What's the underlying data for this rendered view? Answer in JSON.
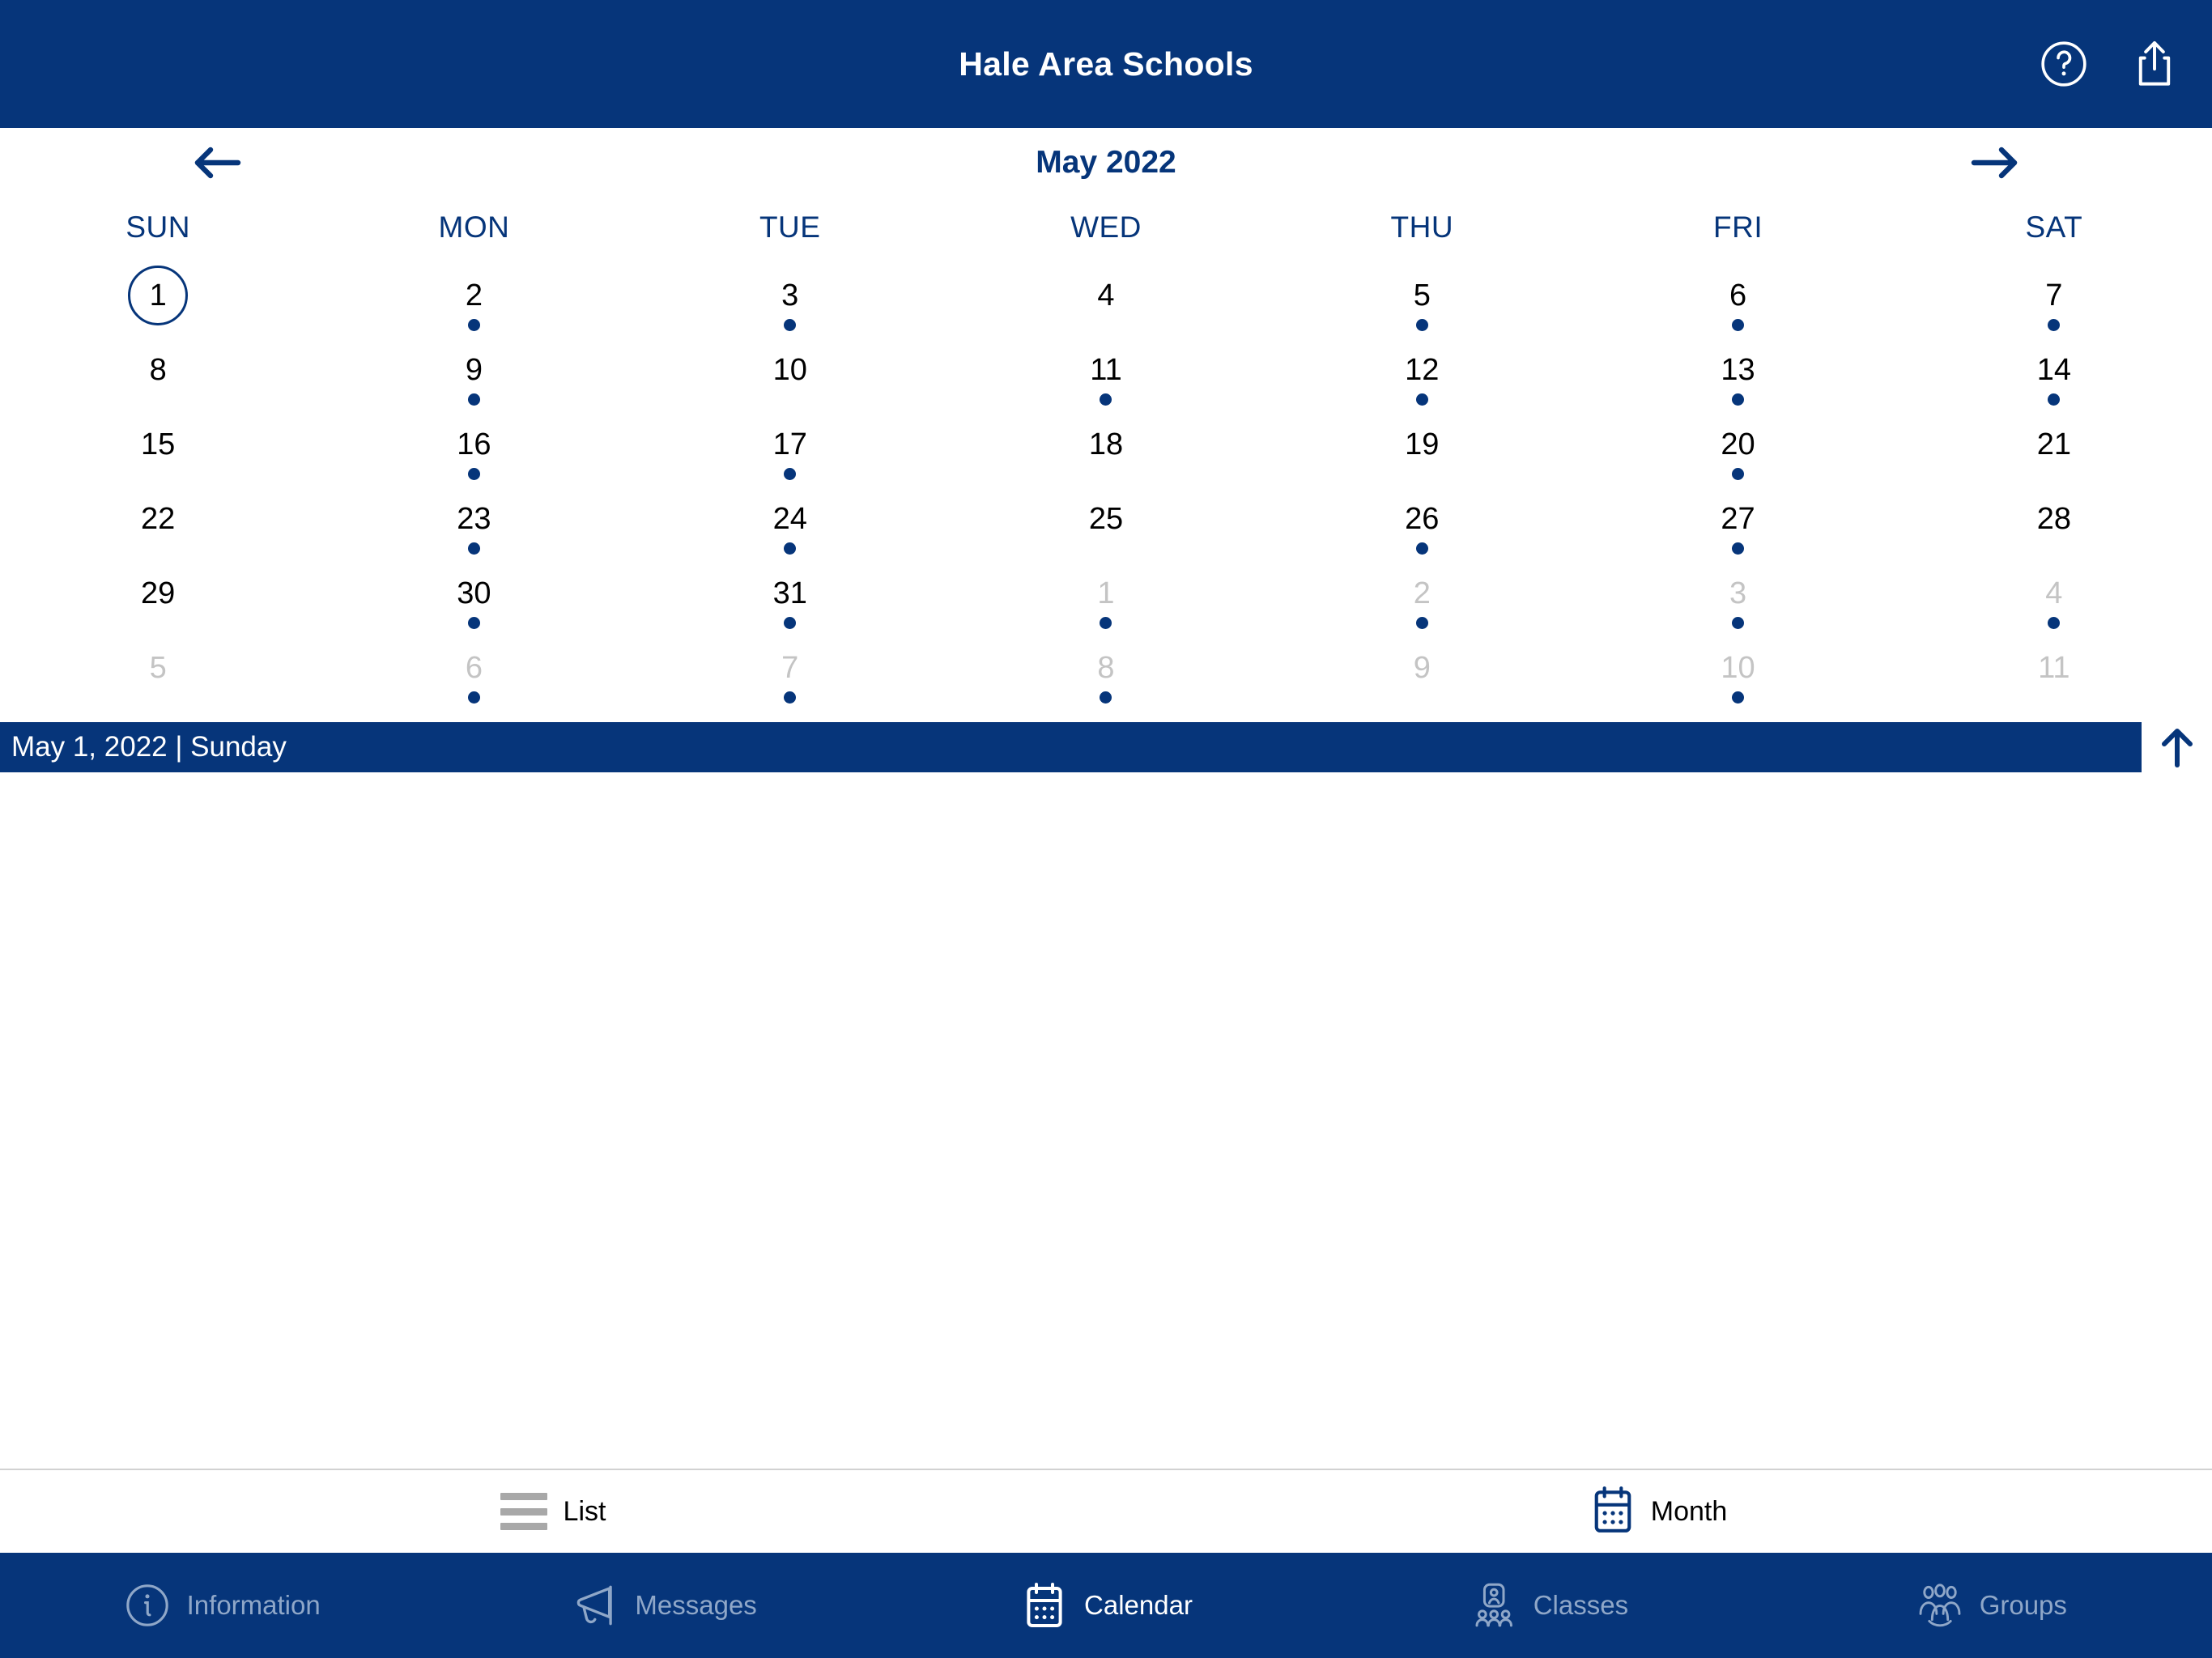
{
  "header": {
    "title": "Hale Area Schools",
    "help_icon": "help-circle-icon",
    "share_icon": "share-icon"
  },
  "calendar": {
    "month_label": "May 2022",
    "prev_icon": "arrow-left-icon",
    "next_icon": "arrow-right-icon",
    "weekdays": [
      "SUN",
      "MON",
      "TUE",
      "WED",
      "THU",
      "FRI",
      "SAT"
    ],
    "days": [
      {
        "num": "1",
        "other": false,
        "dot": false,
        "selected": true
      },
      {
        "num": "2",
        "other": false,
        "dot": true,
        "selected": false
      },
      {
        "num": "3",
        "other": false,
        "dot": true,
        "selected": false
      },
      {
        "num": "4",
        "other": false,
        "dot": false,
        "selected": false
      },
      {
        "num": "5",
        "other": false,
        "dot": true,
        "selected": false
      },
      {
        "num": "6",
        "other": false,
        "dot": true,
        "selected": false
      },
      {
        "num": "7",
        "other": false,
        "dot": true,
        "selected": false
      },
      {
        "num": "8",
        "other": false,
        "dot": false,
        "selected": false
      },
      {
        "num": "9",
        "other": false,
        "dot": true,
        "selected": false
      },
      {
        "num": "10",
        "other": false,
        "dot": false,
        "selected": false
      },
      {
        "num": "11",
        "other": false,
        "dot": true,
        "selected": false
      },
      {
        "num": "12",
        "other": false,
        "dot": true,
        "selected": false
      },
      {
        "num": "13",
        "other": false,
        "dot": true,
        "selected": false
      },
      {
        "num": "14",
        "other": false,
        "dot": true,
        "selected": false
      },
      {
        "num": "15",
        "other": false,
        "dot": false,
        "selected": false
      },
      {
        "num": "16",
        "other": false,
        "dot": true,
        "selected": false
      },
      {
        "num": "17",
        "other": false,
        "dot": true,
        "selected": false
      },
      {
        "num": "18",
        "other": false,
        "dot": false,
        "selected": false
      },
      {
        "num": "19",
        "other": false,
        "dot": false,
        "selected": false
      },
      {
        "num": "20",
        "other": false,
        "dot": true,
        "selected": false
      },
      {
        "num": "21",
        "other": false,
        "dot": false,
        "selected": false
      },
      {
        "num": "22",
        "other": false,
        "dot": false,
        "selected": false
      },
      {
        "num": "23",
        "other": false,
        "dot": true,
        "selected": false
      },
      {
        "num": "24",
        "other": false,
        "dot": true,
        "selected": false
      },
      {
        "num": "25",
        "other": false,
        "dot": false,
        "selected": false
      },
      {
        "num": "26",
        "other": false,
        "dot": true,
        "selected": false
      },
      {
        "num": "27",
        "other": false,
        "dot": true,
        "selected": false
      },
      {
        "num": "28",
        "other": false,
        "dot": false,
        "selected": false
      },
      {
        "num": "29",
        "other": false,
        "dot": false,
        "selected": false
      },
      {
        "num": "30",
        "other": false,
        "dot": true,
        "selected": false
      },
      {
        "num": "31",
        "other": false,
        "dot": true,
        "selected": false
      },
      {
        "num": "1",
        "other": true,
        "dot": true,
        "selected": false
      },
      {
        "num": "2",
        "other": true,
        "dot": true,
        "selected": false
      },
      {
        "num": "3",
        "other": true,
        "dot": true,
        "selected": false
      },
      {
        "num": "4",
        "other": true,
        "dot": true,
        "selected": false
      },
      {
        "num": "5",
        "other": true,
        "dot": false,
        "selected": false
      },
      {
        "num": "6",
        "other": true,
        "dot": true,
        "selected": false
      },
      {
        "num": "7",
        "other": true,
        "dot": true,
        "selected": false
      },
      {
        "num": "8",
        "other": true,
        "dot": true,
        "selected": false
      },
      {
        "num": "9",
        "other": true,
        "dot": false,
        "selected": false
      },
      {
        "num": "10",
        "other": true,
        "dot": true,
        "selected": false
      },
      {
        "num": "11",
        "other": true,
        "dot": false,
        "selected": false
      }
    ]
  },
  "daybar": {
    "text": "May 1, 2022 | Sunday",
    "collapse_icon": "arrow-up-icon"
  },
  "viewswitch": {
    "items": [
      {
        "label": "List",
        "icon": "list-icon",
        "active": false
      },
      {
        "label": "Month",
        "icon": "calendar-icon",
        "active": true
      }
    ]
  },
  "tabbar": {
    "items": [
      {
        "label": "Information",
        "icon": "info-circle-icon",
        "active": false
      },
      {
        "label": "Messages",
        "icon": "megaphone-icon",
        "active": false
      },
      {
        "label": "Calendar",
        "icon": "calendar-icon",
        "active": true
      },
      {
        "label": "Classes",
        "icon": "classes-icon",
        "active": false
      },
      {
        "label": "Groups",
        "icon": "groups-icon",
        "active": false
      }
    ]
  },
  "colors": {
    "navy": "#06357a",
    "muted_tab": "#8fa7c8",
    "inactive_gray": "#a8a8a8",
    "other_month_gray": "#c4c4c4"
  }
}
